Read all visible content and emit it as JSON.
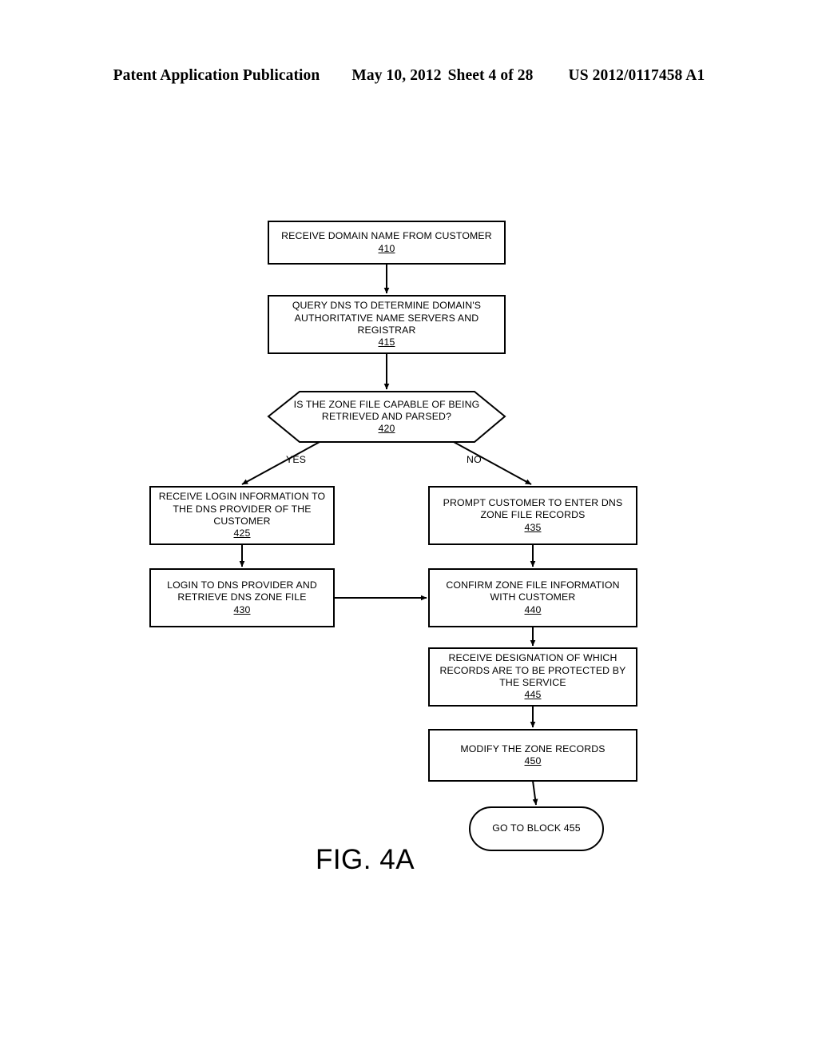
{
  "header": {
    "publication": "Patent Application Publication",
    "date": "May 10, 2012",
    "sheet": "Sheet 4 of 28",
    "patent_number": "US 2012/0117458 A1"
  },
  "figure": {
    "caption": "FIG. 4A"
  },
  "flowchart": {
    "nodes": [
      {
        "id": "410",
        "shape": "process",
        "label": "RECEIVE DOMAIN NAME FROM CUSTOMER",
        "ref": "410"
      },
      {
        "id": "415",
        "shape": "process",
        "label": "QUERY DNS TO DETERMINE DOMAIN'S\nAUTHORITATIVE NAME SERVERS AND\nREGISTRAR",
        "ref": "415"
      },
      {
        "id": "420",
        "shape": "decision",
        "label": "IS THE ZONE FILE CAPABLE OF BEING\nRETRIEVED AND PARSED?",
        "ref": "420"
      },
      {
        "id": "425",
        "shape": "process",
        "label": "RECEIVE LOGIN INFORMATION TO\nTHE DNS PROVIDER OF THE\nCUSTOMER",
        "ref": "425"
      },
      {
        "id": "435",
        "shape": "process",
        "label": "PROMPT CUSTOMER TO ENTER DNS\nZONE FILE RECORDS",
        "ref": "435"
      },
      {
        "id": "430",
        "shape": "process",
        "label": "LOGIN TO DNS PROVIDER AND\nRETRIEVE DNS ZONE FILE",
        "ref": "430"
      },
      {
        "id": "440",
        "shape": "process",
        "label": "CONFIRM ZONE FILE INFORMATION\nWITH CUSTOMER",
        "ref": "440"
      },
      {
        "id": "445",
        "shape": "process",
        "label": "RECEIVE DESIGNATION OF WHICH\nRECORDS ARE TO BE PROTECTED BY\nTHE SERVICE",
        "ref": "445"
      },
      {
        "id": "450",
        "shape": "process",
        "label": "MODIFY THE ZONE RECORDS",
        "ref": "450"
      },
      {
        "id": "455",
        "shape": "terminator",
        "label": "GO TO BLOCK 455",
        "ref": ""
      }
    ],
    "edges": [
      {
        "from": "410",
        "to": "415",
        "label": ""
      },
      {
        "from": "415",
        "to": "420",
        "label": ""
      },
      {
        "from": "420",
        "to": "425",
        "label": "YES"
      },
      {
        "from": "420",
        "to": "435",
        "label": "NO"
      },
      {
        "from": "425",
        "to": "430",
        "label": ""
      },
      {
        "from": "435",
        "to": "440",
        "label": ""
      },
      {
        "from": "430",
        "to": "440",
        "label": ""
      },
      {
        "from": "440",
        "to": "445",
        "label": ""
      },
      {
        "from": "445",
        "to": "450",
        "label": ""
      },
      {
        "from": "450",
        "to": "455",
        "label": ""
      }
    ],
    "branch_labels": {
      "yes": "YES",
      "no": "NO"
    }
  },
  "colors": {
    "ink": "#000000",
    "page": "#ffffff"
  }
}
